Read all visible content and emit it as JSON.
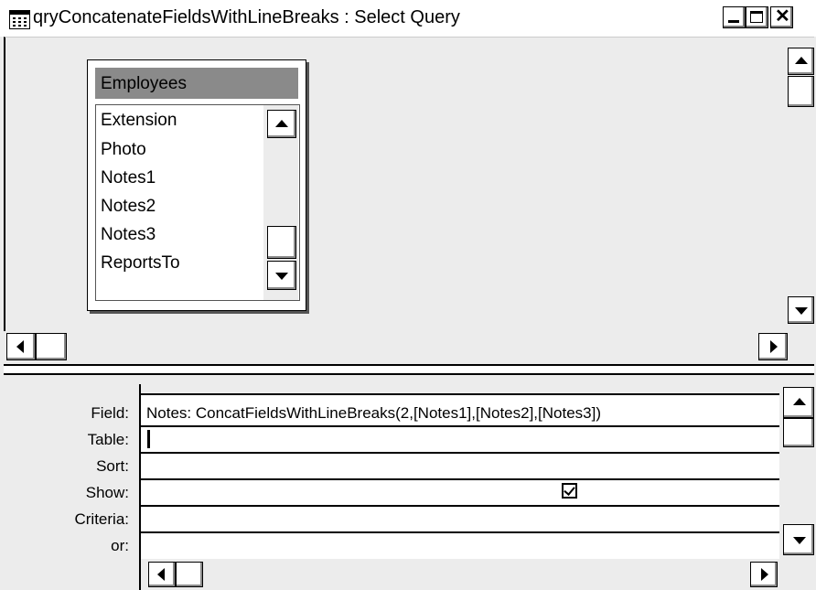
{
  "window": {
    "title": "qryConcatenateFieldsWithLineBreaks : Select Query"
  },
  "table": {
    "name": "Employees",
    "fields": [
      "Extension",
      "Photo",
      "Notes1",
      "Notes2",
      "Notes3",
      "ReportsTo"
    ]
  },
  "grid": {
    "row_labels": [
      "Field:",
      "Table:",
      "Sort:",
      "Show:",
      "Criteria:",
      "or:"
    ],
    "field_value": "Notes: ConcatFieldsWithLineBreaks(2,[Notes1],[Notes2],[Notes3])",
    "table_value": "",
    "sort_value": "",
    "show_checked": true,
    "criteria_value": "",
    "or_value": ""
  },
  "icons": {
    "title": "query-icon",
    "minimize": "minimize-icon",
    "maximize": "maximize-icon",
    "close": "close-icon"
  }
}
